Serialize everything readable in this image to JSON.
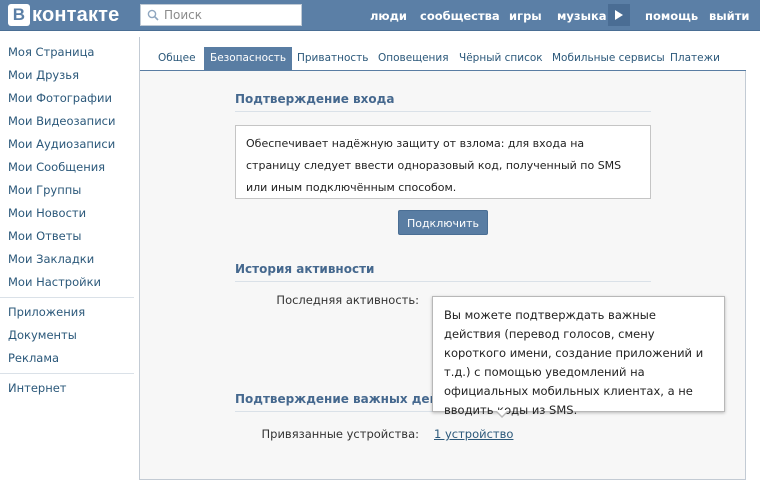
{
  "header": {
    "logo_text": "контакте",
    "logo_letter": "В",
    "search_placeholder": "Поиск",
    "nav": {
      "people": "люди",
      "communities": "сообщества",
      "games": "игры",
      "music": "музыка",
      "help": "помощь",
      "logout": "выйти"
    },
    "colors": {
      "bar": "#5b7fa6",
      "link": "#2b587a",
      "accent": "#597da3"
    }
  },
  "sidebar": {
    "items": [
      "Моя Страница",
      "Мои Друзья",
      "Мои Фотографии",
      "Мои Видеозаписи",
      "Мои Аудиозаписи",
      "Мои Сообщения",
      "Мои Группы",
      "Мои Новости",
      "Мои Ответы",
      "Мои Закладки",
      "Мои Настройки"
    ],
    "extra_items": [
      "Приложения",
      "Документы",
      "Реклама"
    ],
    "bottom_items": [
      "Интернет"
    ]
  },
  "tabs": [
    "Общее",
    "Безопасность",
    "Приватность",
    "Оповещения",
    "Чёрный список",
    "Мобильные сервисы",
    "Платежи"
  ],
  "active_tab": "Безопасность",
  "login_confirm": {
    "title": "Подтверждение входа",
    "description": "Обеспечивает надёжную защиту от взлома: для входа на страницу следует ввести одноразовый код, полученный по SMS или иным подключённым способом.",
    "button": "Подключить"
  },
  "activity": {
    "title": "История активности",
    "last_activity_label": "Последняя активность:"
  },
  "important_actions": {
    "title": "Подтверждение важных действий",
    "devices_label": "Привязанные устройства:",
    "devices_link": "1 устройство",
    "tooltip": "Вы можете подтверждать важные действия (перевод голосов, смену короткого имени, создание приложений и т.д.) с помощью уведомлений на официальных мобильных клиентах, а не вводить коды из SMS."
  }
}
